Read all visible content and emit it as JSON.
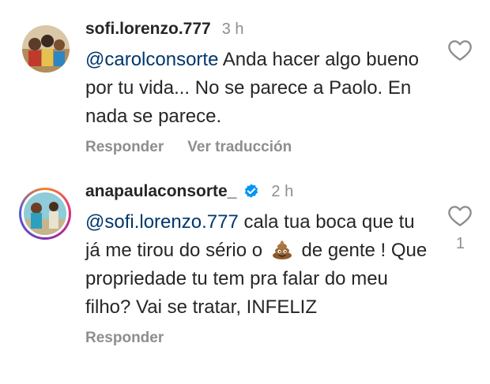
{
  "comments": [
    {
      "username": "sofi.lorenzo.777",
      "time": "3 h",
      "mention": "@carolconsorte",
      "text": "Anda hacer algo bueno por tu vida... No se parece a Paolo. En nada se parece.",
      "actions": {
        "reply": "Responder",
        "translate": "Ver traducción"
      },
      "likes": ""
    },
    {
      "username": "anapaulaconsorte_",
      "verified": true,
      "time": "2 h",
      "mention": "@sofi.lorenzo.777",
      "text_before_emoji": "cala tua boca que tu já me tirou do sério o",
      "text_after_emoji": "de gente ! Que propriedade tu tem pra falar do meu filho? Vai se tratar, INFELIZ",
      "emoji": "pile-of-poo",
      "actions": {
        "reply": "Responder"
      },
      "likes": "1"
    }
  ],
  "colors": {
    "text": "#262626",
    "secondary": "#8e8e8e",
    "mention": "#00376b",
    "verified": "#0095f6"
  }
}
